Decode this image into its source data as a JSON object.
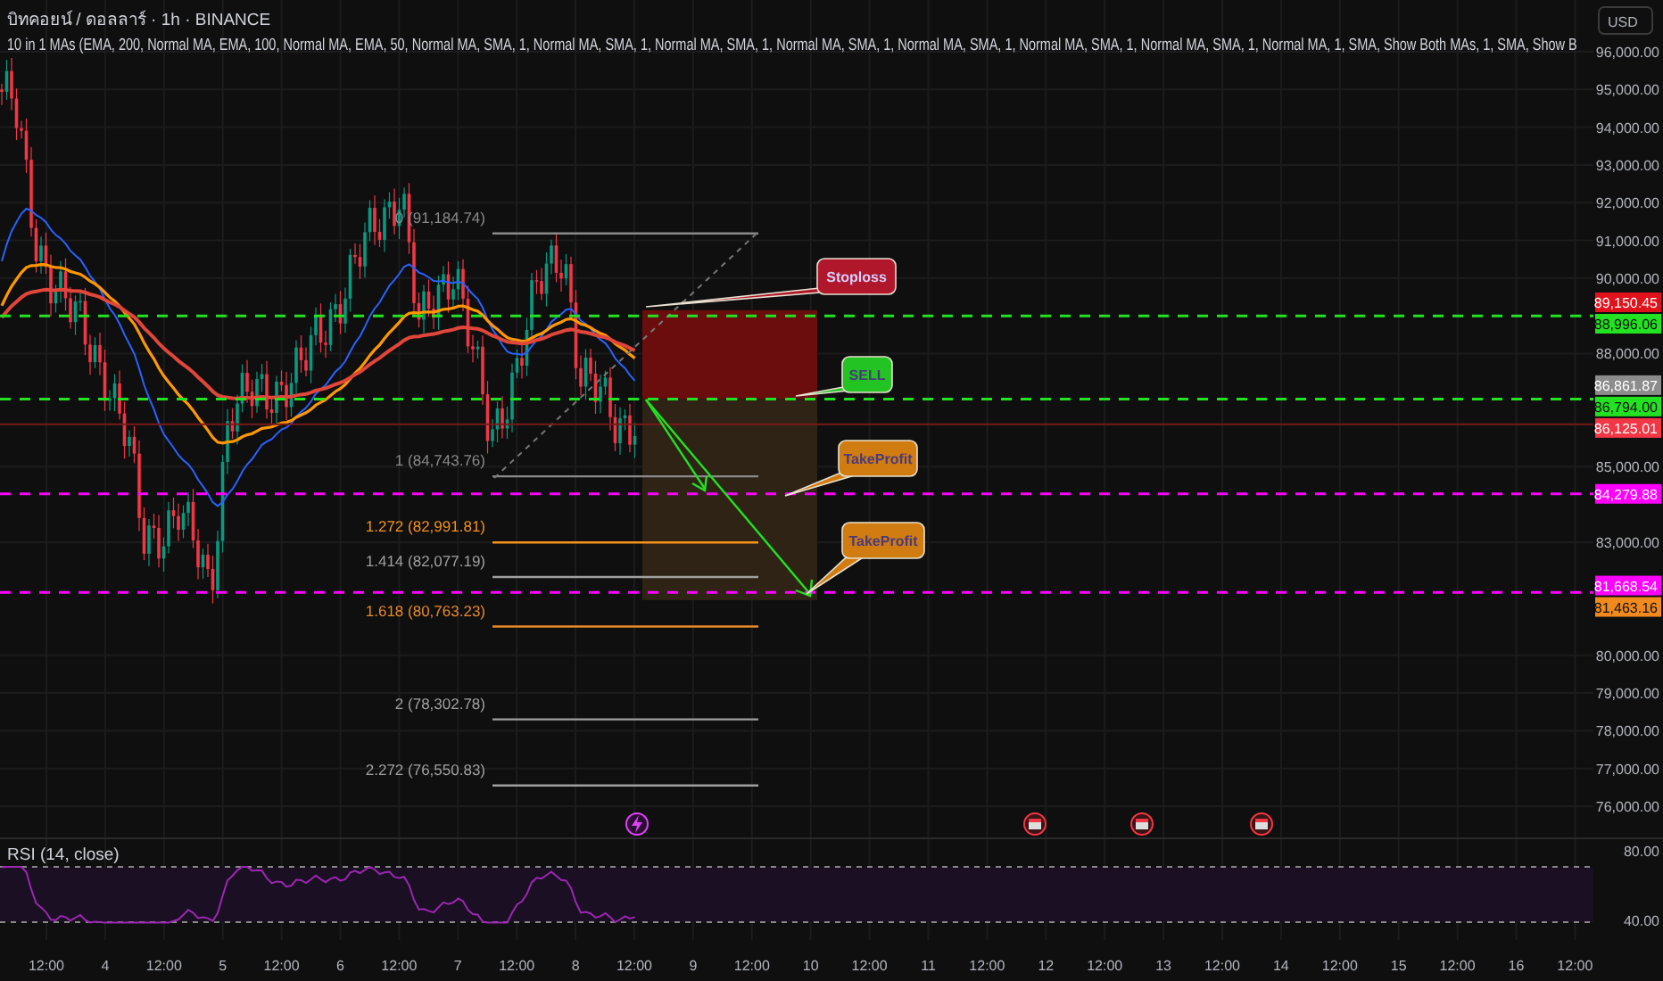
{
  "header": {
    "title": "บิทคอยน์ / ดอลลาร์ · 1h · BINANCE",
    "indicator": "10 in 1 MAs (EMA, 200, Normal MA, EMA, 100, Normal MA, EMA, 50, Normal MA, SMA, 1, Normal MA, SMA, 1, Normal MA, SMA, 1, Normal MA, SMA, 1, Normal MA, SMA, 1, Normal MA, SMA, 1, Normal MA, SMA, 1, Normal MA, 1, SMA, Show Both MAs, 1, SMA, Show B"
  },
  "currency_button": "USD",
  "price_axis": [
    "96,000.00",
    "95,000.00",
    "94,000.00",
    "93,000.00",
    "92,000.00",
    "91,000.00",
    "90,000.00",
    "88,000.00",
    "85,000.00",
    "83,000.00",
    "80,000.00",
    "79,000.00",
    "78,000.00",
    "77,000.00",
    "76,000.00"
  ],
  "price_labels": [
    {
      "label": "89,150.45",
      "color": "#e0121b"
    },
    {
      "label": "88,996.06",
      "color": "#22e222"
    },
    {
      "label": "86,861.87",
      "color": "#8c8c8c"
    },
    {
      "label": "86,794.00",
      "color": "#22e222"
    },
    {
      "label": "86,125.01",
      "color": "#f23645"
    },
    {
      "label": "84,279.88",
      "color": "#ff00ff"
    },
    {
      "label": "81,668.54",
      "color": "#ff00ff"
    },
    {
      "label": "81,463.16",
      "color": "#f08a1c"
    }
  ],
  "callouts": [
    {
      "text": "Stoploss",
      "color": "#b0172b"
    },
    {
      "text": "SELL",
      "color": "#22c322"
    },
    {
      "text": "TakeProfit",
      "color": "#d07c10"
    },
    {
      "text": "TakeProfit",
      "color": "#d07c10"
    }
  ],
  "fib_levels": [
    {
      "label": "0 (91,184.74)",
      "color": "#8a8a8a"
    },
    {
      "label": "1 (84,743.76)",
      "color": "#8a8a8a"
    },
    {
      "label": "1.272 (82,991.81)",
      "color": "#f7931a"
    },
    {
      "label": "1.414 (82,077.19)",
      "color": "#a0a0a0"
    },
    {
      "label": "1.618 (80,763.23)",
      "color": "#e8892a"
    },
    {
      "label": "2 (78,302.78)",
      "color": "#a0a0a0"
    },
    {
      "label": "2.272 (76,550.83)",
      "color": "#a0a0a0"
    }
  ],
  "rsi": {
    "label": "RSI (14, close)",
    "upper": "80.00",
    "lower": "40.00"
  },
  "time_axis": [
    "12:00",
    "4",
    "12:00",
    "5",
    "12:00",
    "6",
    "12:00",
    "7",
    "12:00",
    "8",
    "12:00",
    "9",
    "12:00",
    "10",
    "12:00",
    "11",
    "12:00",
    "12",
    "12:00",
    "13",
    "12:00",
    "14",
    "12:00",
    "15",
    "12:00",
    "16",
    "12:00"
  ]
}
